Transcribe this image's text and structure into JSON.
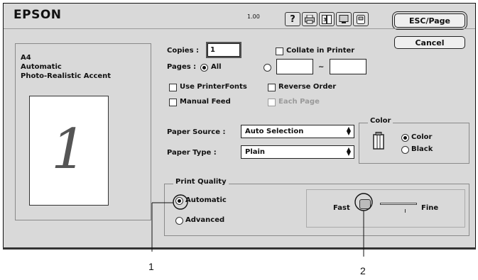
{
  "header": {
    "brand": "EPSON",
    "version": "1.00",
    "toolbar_icons": [
      "help-icon",
      "printer-icon",
      "layout-icon",
      "monitor-icon",
      "save-icon"
    ],
    "help_glyph": "?",
    "esc_page_label": "ESC/Page",
    "cancel_label": "Cancel"
  },
  "summary": {
    "paper": "A4",
    "mode": "Automatic",
    "setting": "Photo-Realistic Accent",
    "preview_page_number": "1"
  },
  "copies": {
    "label": "Copies :",
    "value": "1",
    "collate_label": "Collate in Printer",
    "collate_checked": false
  },
  "pages": {
    "label": "Pages :",
    "all_label": "All",
    "all_selected": true,
    "range_separator": "~",
    "from": "",
    "to": ""
  },
  "options": {
    "use_printer_fonts": "Use PrinterFonts",
    "reverse_order": "Reverse Order",
    "manual_feed": "Manual Feed",
    "each_page": "Each Page"
  },
  "paper_source": {
    "label": "Paper Source :",
    "value": "Auto Selection"
  },
  "paper_type": {
    "label": "Paper Type :",
    "value": "Plain"
  },
  "color": {
    "group_label": "Color",
    "color_option": "Color",
    "black_option": "Black",
    "selected": "Color"
  },
  "print_quality": {
    "group_label": "Print Quality",
    "automatic_label": "Automatic",
    "advanced_label": "Advanced",
    "selected": "Automatic",
    "fast_label": "Fast",
    "fine_label": "Fine",
    "slider_level": 0
  },
  "callouts": {
    "one": "1",
    "two": "2"
  }
}
